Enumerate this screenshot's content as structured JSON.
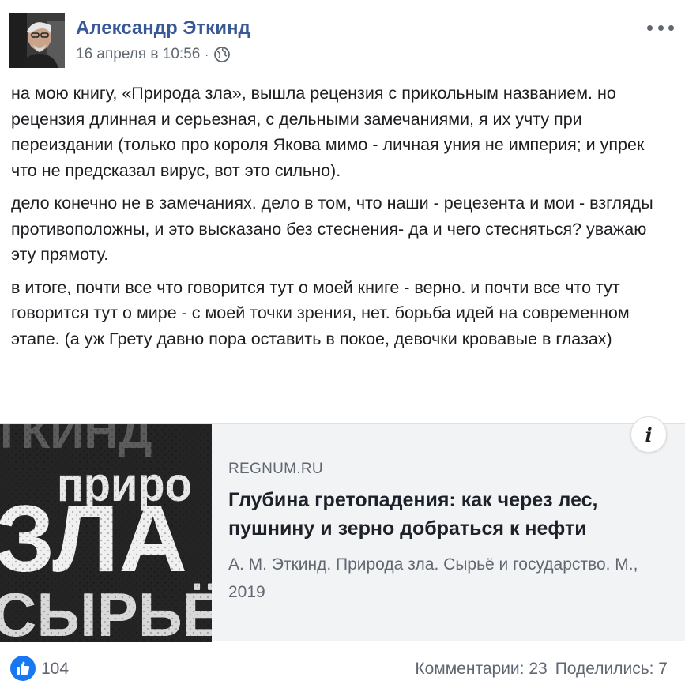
{
  "author": {
    "name": "Александр Эткинд",
    "date": "16 апреля в 10:56",
    "separator": "·",
    "privacy_icon": "globe-icon"
  },
  "post": {
    "paragraphs": [
      "на мою книгу, «Природа зла», вышла рецензия с прикольным названием. но рецензия длинная и серьезная, с дельными замечаниями, я их учту при переиздании (только про короля Якова мимо - личная уния не империя; и упрек что не предсказал вирус, вот это сильно).",
      "дело конечно не в замечаниях. дело в том, что наши - рецезента и мои - взгляды противоположны, и это высказано без стеснения- да и чего стесняться? уважаю эту прямоту.",
      "в итоге, почти все что говорится тут о моей книге - верно. и почти все что тут говорится тут о мире - с моей точки зрения, нет. борьба идей на современном этапе. (а уж Грету давно пора оставить в покое, девочки кровавые в глазах)"
    ]
  },
  "link_preview": {
    "domain": "REGNUM.RU",
    "title": "Глубина гретопадения: как через лес, пушнину и зерно добраться к нефти",
    "description": "А. М. Эткинд. Природа зла. Сырьё и государство. М., 2019",
    "info_label": "i",
    "thumbnail_words": [
      "ТКИНД",
      "приро",
      "ЗЛА",
      "СЫРЬЁ"
    ]
  },
  "footer": {
    "like_count": "104",
    "comments": "Комментарии: 23",
    "shares": "Поделились: 7"
  },
  "colors": {
    "author_link": "#385898",
    "like_blue": "#1877f2",
    "muted": "#606770"
  }
}
